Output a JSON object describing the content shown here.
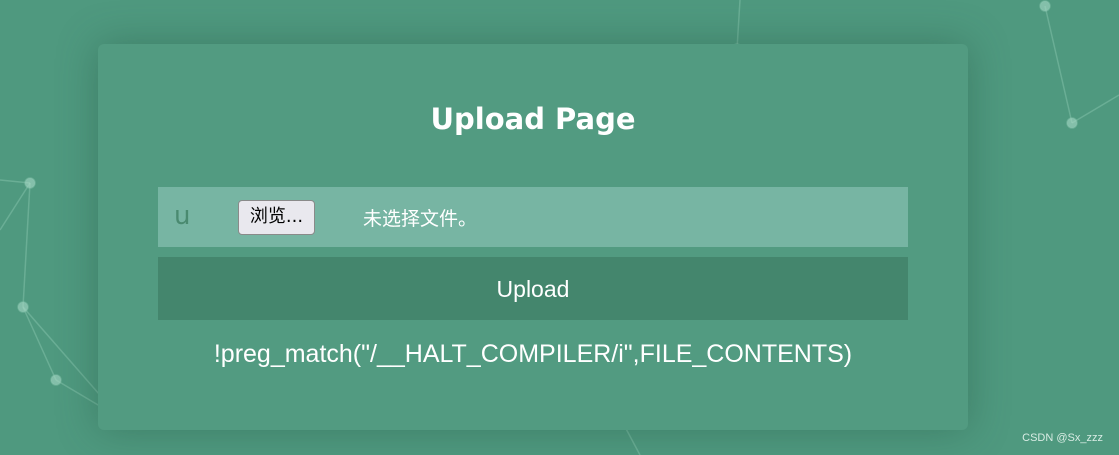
{
  "page": {
    "title": "Upload Page"
  },
  "form": {
    "prefix": "u",
    "browse_label": "浏览...",
    "file_status": "未选择文件。",
    "upload_label": "Upload"
  },
  "hint": "!preg_match(\"/__HALT_COMPILER/i\",FILE_CONTENTS)",
  "watermark": "CSDN @Sx_zzz",
  "colors": {
    "background": "#4f997f",
    "file_row": "#77b5a3",
    "upload_button": "#44866d"
  }
}
